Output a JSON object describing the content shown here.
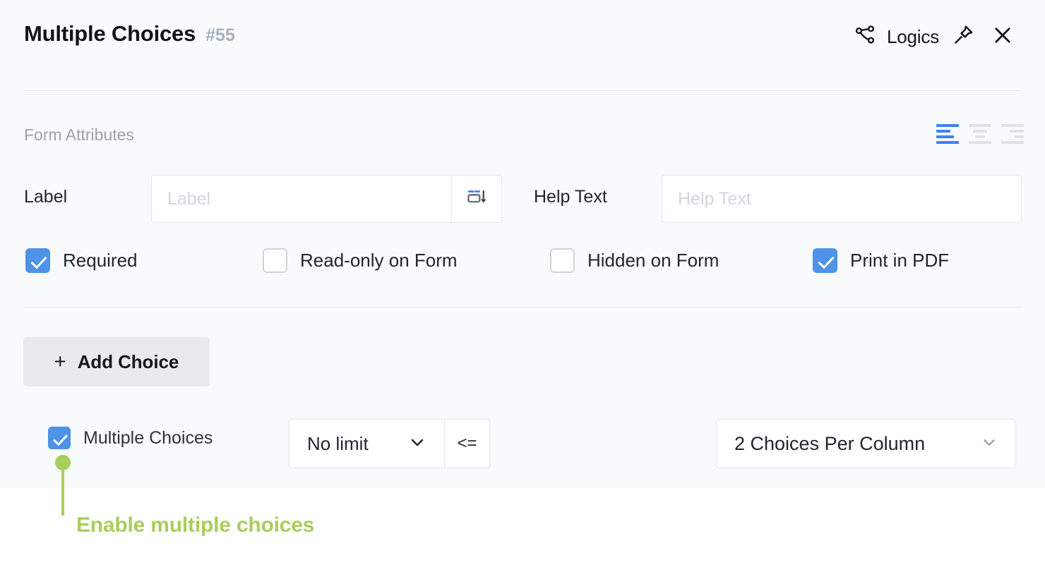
{
  "header": {
    "title": "Multiple Choices",
    "field_number": "#55",
    "logics_label": "Logics",
    "icons": {
      "logics": "share-nodes-icon",
      "pin": "pin-icon",
      "close": "close-icon"
    }
  },
  "form_attributes": {
    "section_label": "Form Attributes",
    "alignment": {
      "options": [
        "left",
        "center",
        "right"
      ],
      "selected": "left",
      "active_color": "#3b82f6",
      "inactive_color": "#dfe3e8"
    },
    "fields": [
      {
        "label": "Label",
        "placeholder": "Label",
        "value": "",
        "suffix_icon": "label-position-icon"
      },
      {
        "label": "Help Text",
        "placeholder": "Help Text",
        "value": "",
        "suffix_icon": ""
      }
    ],
    "checkboxes": [
      {
        "label": "Required",
        "checked": true
      },
      {
        "label": "Read-only on Form",
        "checked": false
      },
      {
        "label": "Hidden on Form",
        "checked": false
      },
      {
        "label": "Print in PDF",
        "checked": true
      }
    ]
  },
  "choices": {
    "add_button": {
      "label": "Add Choice",
      "plus": "+"
    },
    "multiple_choices": {
      "label": "Multiple Choices",
      "checked": true
    },
    "limit_select": {
      "value": "No limit",
      "suffix": "<=",
      "chevron": "chevron-down-icon"
    },
    "per_column_select": {
      "value": "2 Choices Per Column",
      "chevron": "chevron-down-icon"
    }
  },
  "annotation": {
    "text": "Enable multiple choices",
    "color": "#a8ce5c"
  },
  "colors": {
    "panel_bg": "#f8fafc",
    "page_bg": "#ffffff",
    "checkbox_checked": "#4e93e6",
    "accent_blue": "#3b82f6",
    "annotation_green": "#a8ce5c",
    "divider": "#e6e9ee"
  }
}
